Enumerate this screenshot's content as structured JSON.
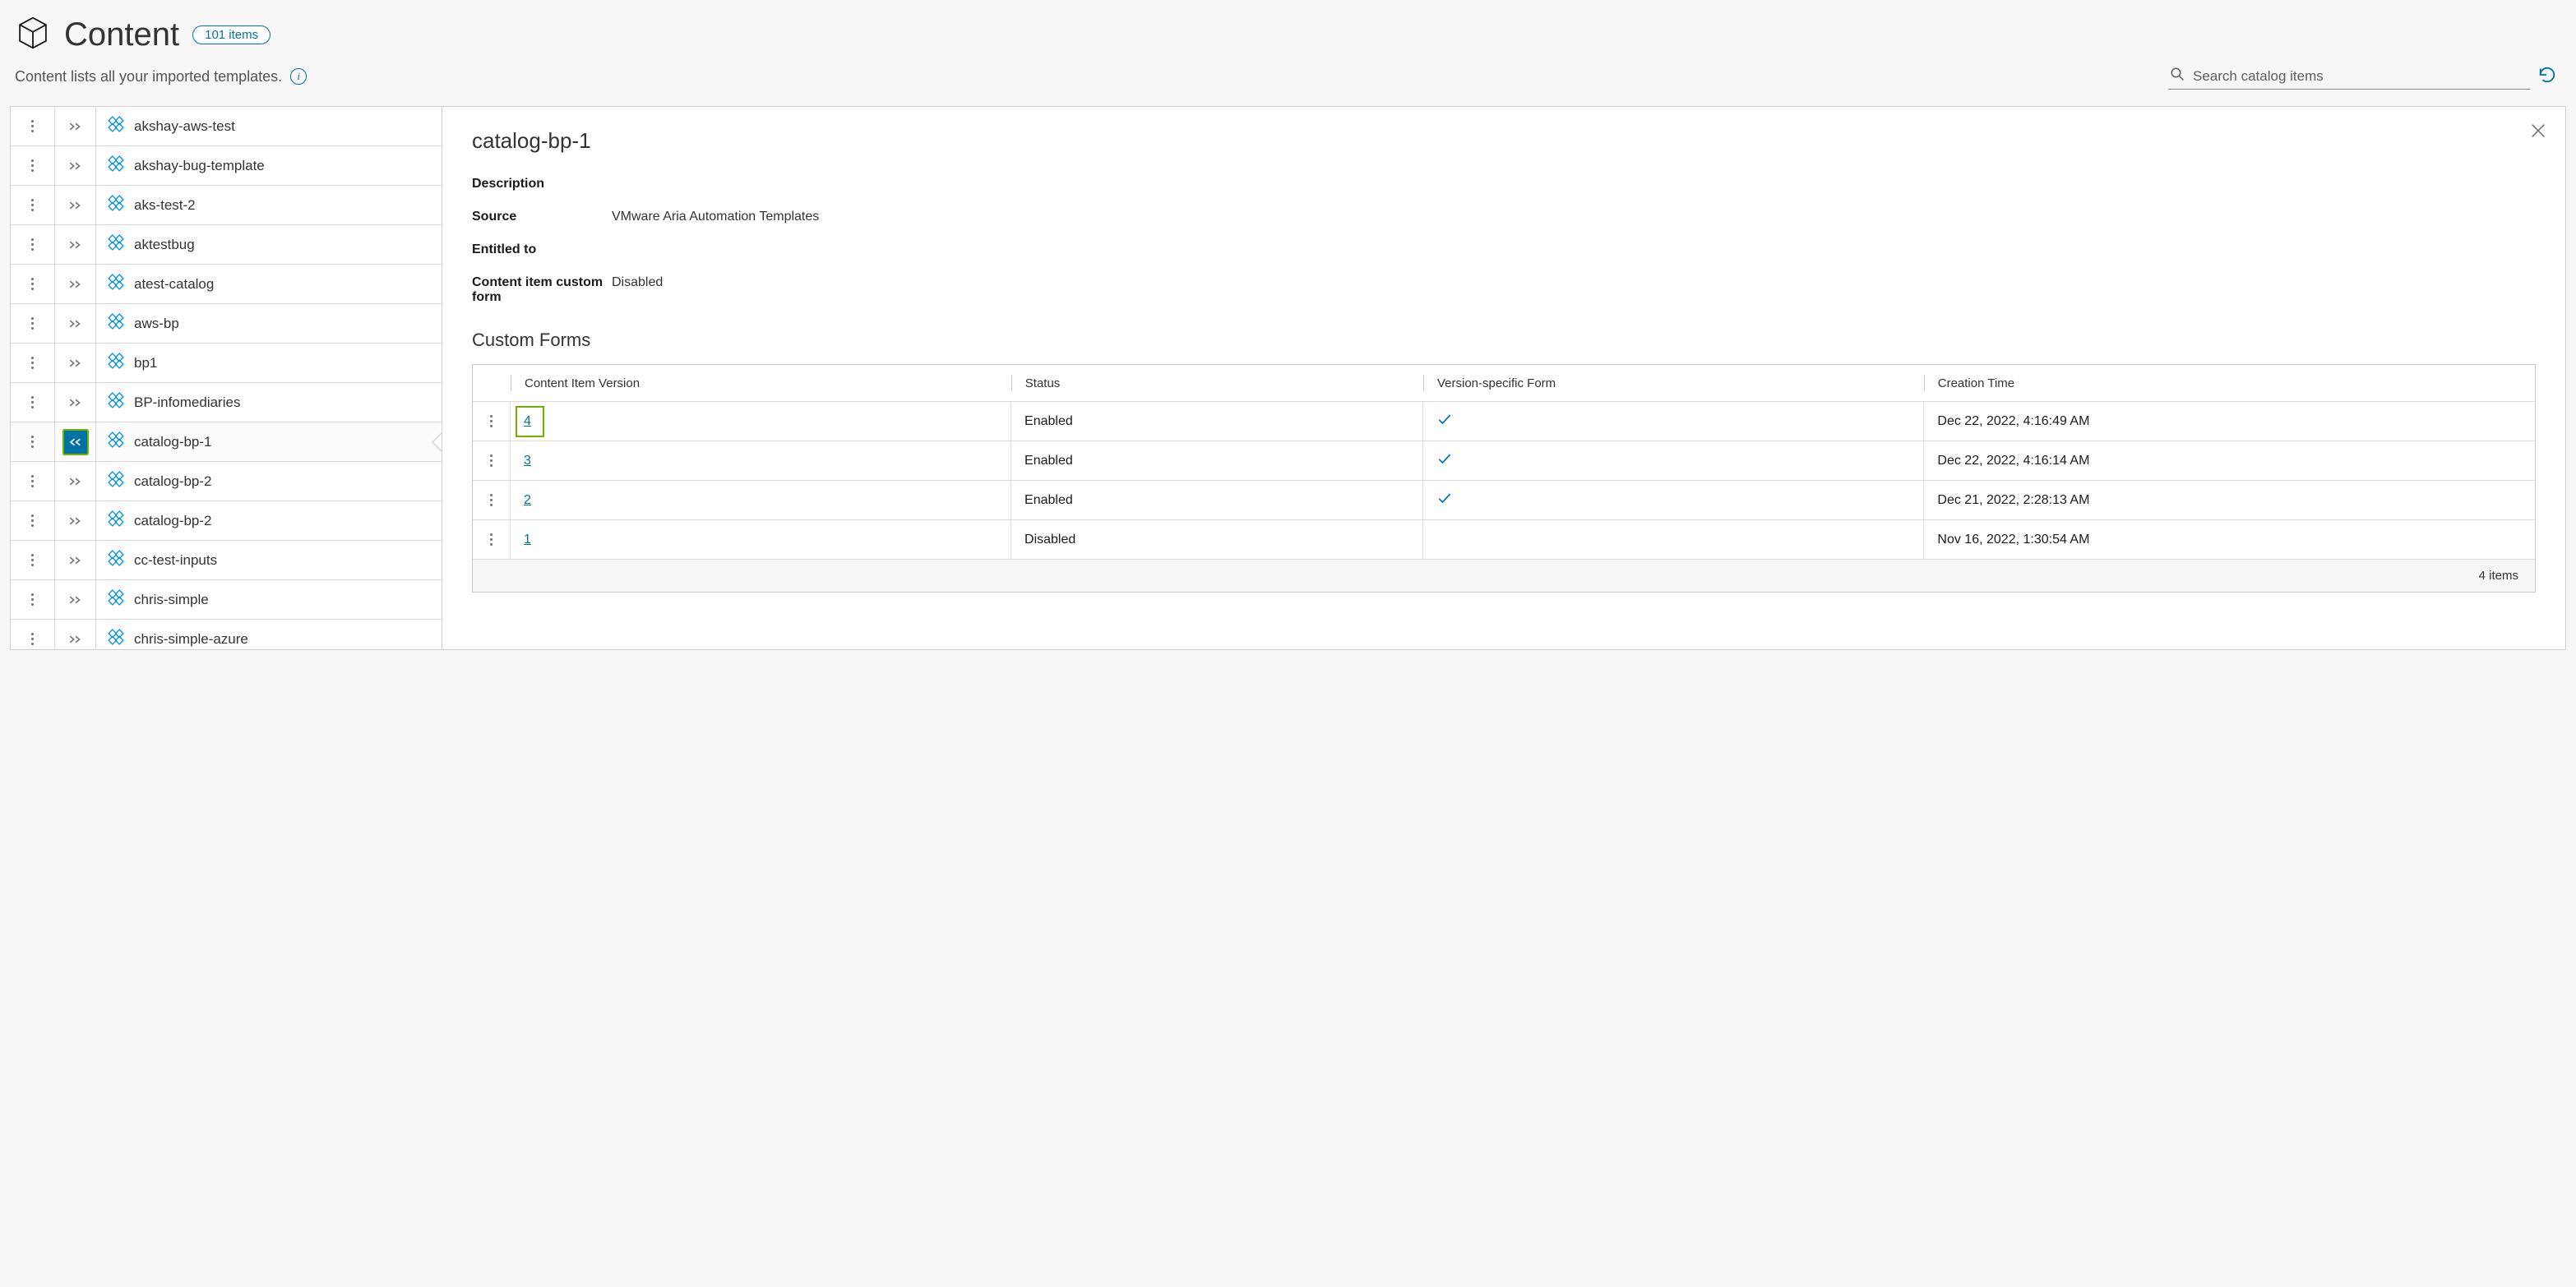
{
  "header": {
    "title": "Content",
    "items_badge": "101 items",
    "subtitle": "Content lists all your imported templates.",
    "search_placeholder": "Search catalog items"
  },
  "list": [
    {
      "name": "akshay-aws-test",
      "selected": false
    },
    {
      "name": "akshay-bug-template",
      "selected": false
    },
    {
      "name": "aks-test-2",
      "selected": false
    },
    {
      "name": "aktestbug",
      "selected": false
    },
    {
      "name": "atest-catalog",
      "selected": false
    },
    {
      "name": "aws-bp",
      "selected": false
    },
    {
      "name": "bp1",
      "selected": false
    },
    {
      "name": "BP-infomediaries",
      "selected": false
    },
    {
      "name": "catalog-bp-1",
      "selected": true
    },
    {
      "name": "catalog-bp-2",
      "selected": false
    },
    {
      "name": "catalog-bp-2",
      "selected": false
    },
    {
      "name": "cc-test-inputs",
      "selected": false
    },
    {
      "name": "chris-simple",
      "selected": false
    },
    {
      "name": "chris-simple-azure",
      "selected": false
    }
  ],
  "detail": {
    "title": "catalog-bp-1",
    "fields": {
      "description_label": "Description",
      "description_value": "",
      "source_label": "Source",
      "source_value": "VMware Aria Automation Templates",
      "entitled_label": "Entitled to",
      "entitled_value": "",
      "custom_form_label": "Content item custom form",
      "custom_form_value": "Disabled"
    },
    "custom_forms": {
      "heading": "Custom Forms",
      "columns": {
        "version": "Content Item Version",
        "status": "Status",
        "form": "Version-specific Form",
        "time": "Creation Time"
      },
      "rows": [
        {
          "version": "4",
          "status": "Enabled",
          "form": true,
          "time": "Dec 22, 2022, 4:16:49 AM",
          "highlight": true
        },
        {
          "version": "3",
          "status": "Enabled",
          "form": true,
          "time": "Dec 22, 2022, 4:16:14 AM",
          "highlight": false
        },
        {
          "version": "2",
          "status": "Enabled",
          "form": true,
          "time": "Dec 21, 2022, 2:28:13 AM",
          "highlight": false
        },
        {
          "version": "1",
          "status": "Disabled",
          "form": false,
          "time": "Nov 16, 2022, 1:30:54 AM",
          "highlight": false
        }
      ],
      "footer": "4 items"
    }
  }
}
